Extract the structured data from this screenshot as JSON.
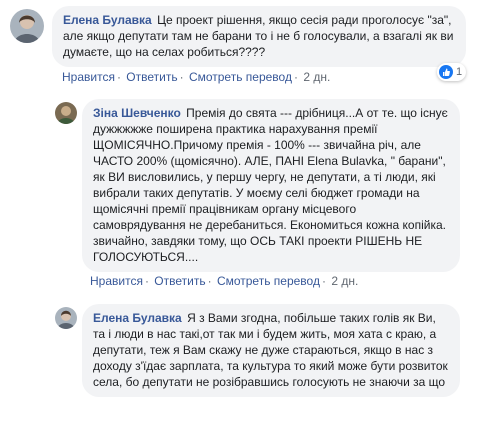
{
  "comments": [
    {
      "author": "Елена Булавка",
      "text": "Це проект рішення, якщо сесія ради проголосує \"за\", але якщо депутати там не барани то і не б голосували, а взагалі як ви думаєте, що на селах робиться????",
      "actions": {
        "like": "Нравится",
        "reply": "Ответить",
        "translate": "Смотреть перевод",
        "time": "2 дн."
      },
      "reactions": {
        "count": "1",
        "icon": "like-icon"
      }
    },
    {
      "author": "Зіна Шевченко",
      "text": "Премія до свята --- дрібниця...А от те. що існує дужжжжже поширена практика нарахування премії ЩОМІСЯЧНО.Причому премія - 100% --- звичайна річ, але ЧАСТО 200% (щомісячно). АЛЕ, ПАНІ Elena Bulavka, \" барани\", як ВИ висловились, у першу чергу, не депутати, а ті люди, які вибрали таких депутатів. У моєму селі бюджет громади на щомісячні премії працівникам органу місцевого самоврядування не деребаниться. Економиться кожна копійка. звичайно, завдяки тому, що ОСЬ ТАКІ проекти РІШЕНЬ НЕ ГОЛОСУЮТЬСЯ....",
      "actions": {
        "like": "Нравится",
        "reply": "Ответить",
        "translate": "Смотреть перевод",
        "time": "2 дн."
      }
    },
    {
      "author": "Елена Булавка",
      "text": "Я з Вами згодна, побільше таких голів як Ви, та і люди в нас такі,от так ми і будем жить, моя хата с краю, а депутати, теж я Вам скажу не дуже стараються, якщо в нас з доходу з'їдає зарплата, та культура то який може бути розвиток села, бо депутати не розібравшись голосують не знаючи за що"
    }
  ],
  "colors": {
    "author": "#385898",
    "bubble": "#f2f3f5",
    "like": "#1877f2"
  }
}
